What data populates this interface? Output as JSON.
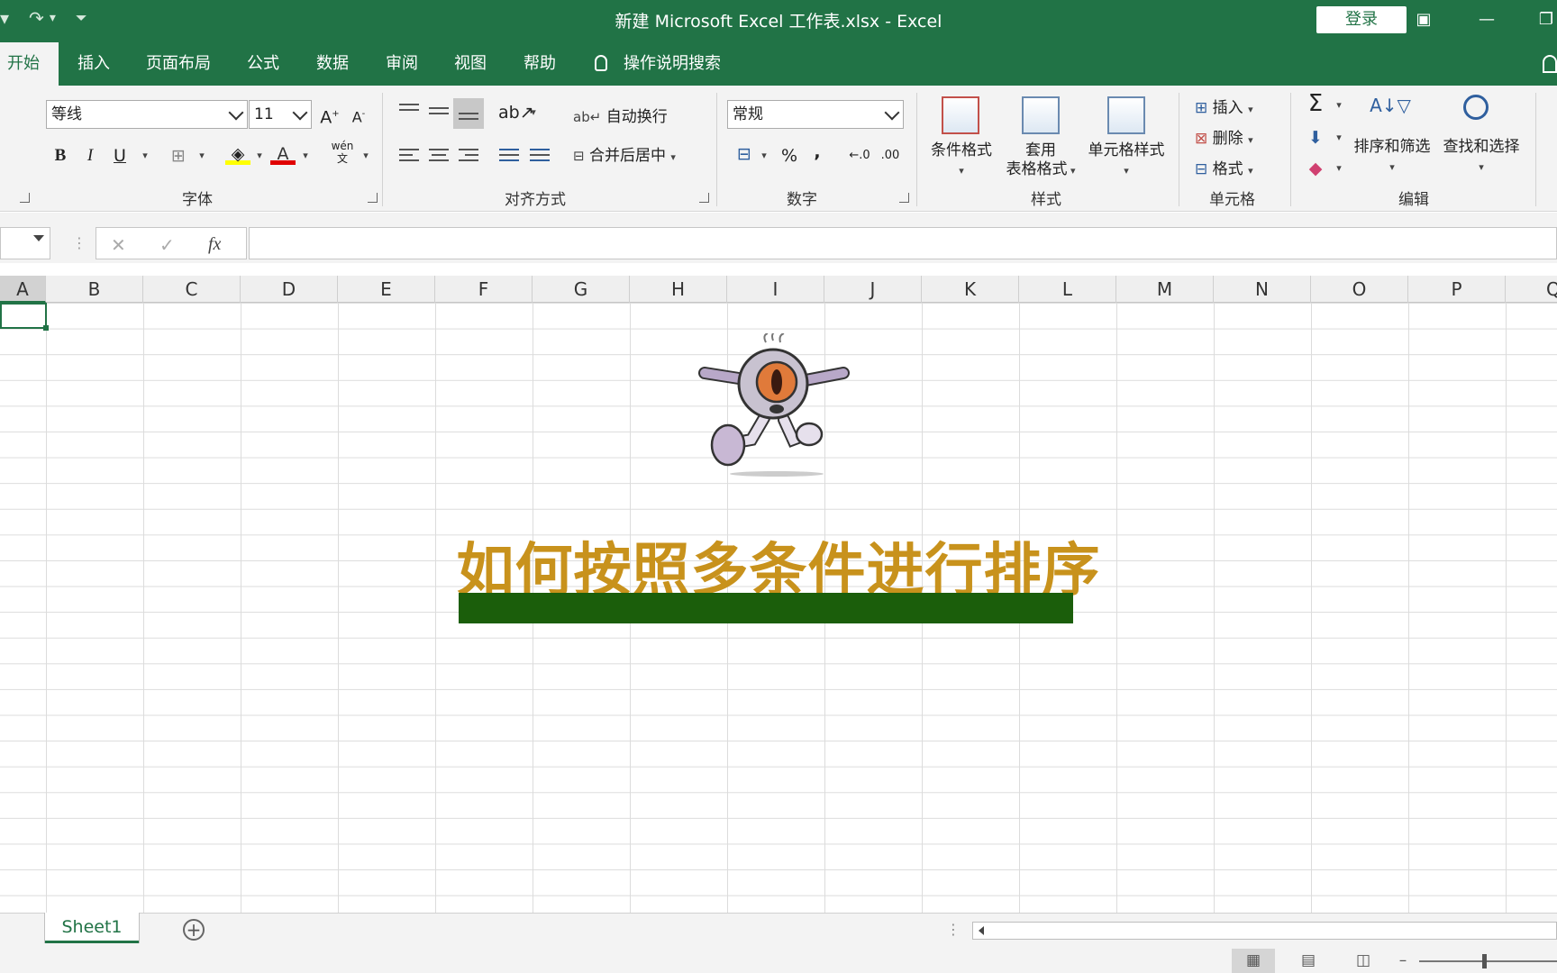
{
  "window": {
    "title": "新建 Microsoft Excel 工作表.xlsx  -  Excel",
    "login_label": "登录"
  },
  "ribbon_tabs": [
    "开始",
    "插入",
    "页面布局",
    "公式",
    "数据",
    "审阅",
    "视图",
    "帮助"
  ],
  "tell_me": "操作说明搜索",
  "font_group": {
    "font_name": "等线",
    "font_size": "11",
    "bold": "B",
    "italic": "I",
    "underline": "U",
    "phonetic": "wén",
    "label": "字体"
  },
  "alignment_group": {
    "wrap_text": "自动换行",
    "merge_center": "合并后居中",
    "label": "对齐方式"
  },
  "number_group": {
    "format": "常规",
    "percent": "%",
    "comma": ",",
    "label": "数字"
  },
  "styles_group": {
    "conditional": "条件格式",
    "table_format_line1": "套用",
    "table_format_line2": "表格格式",
    "cell_styles": "单元格样式",
    "label": "样式"
  },
  "cells_group": {
    "insert": "插入",
    "delete": "删除",
    "format": "格式",
    "label": "单元格"
  },
  "editing_group": {
    "sort_filter": "排序和筛选",
    "find_select": "查找和选择",
    "label": "编辑"
  },
  "formula_bar": {
    "fx": "fx",
    "value": ""
  },
  "columns": [
    "A",
    "B",
    "C",
    "D",
    "E",
    "F",
    "G",
    "H",
    "I",
    "J",
    "K",
    "L",
    "M",
    "N",
    "O",
    "P",
    "Q"
  ],
  "overlay": {
    "headline": "如何按照多条件进行排序",
    "headline_color": "#c8921c",
    "bar_color": "#1b5e0b"
  },
  "sheets": [
    "Sheet1"
  ],
  "colors": {
    "accent": "#217346"
  }
}
